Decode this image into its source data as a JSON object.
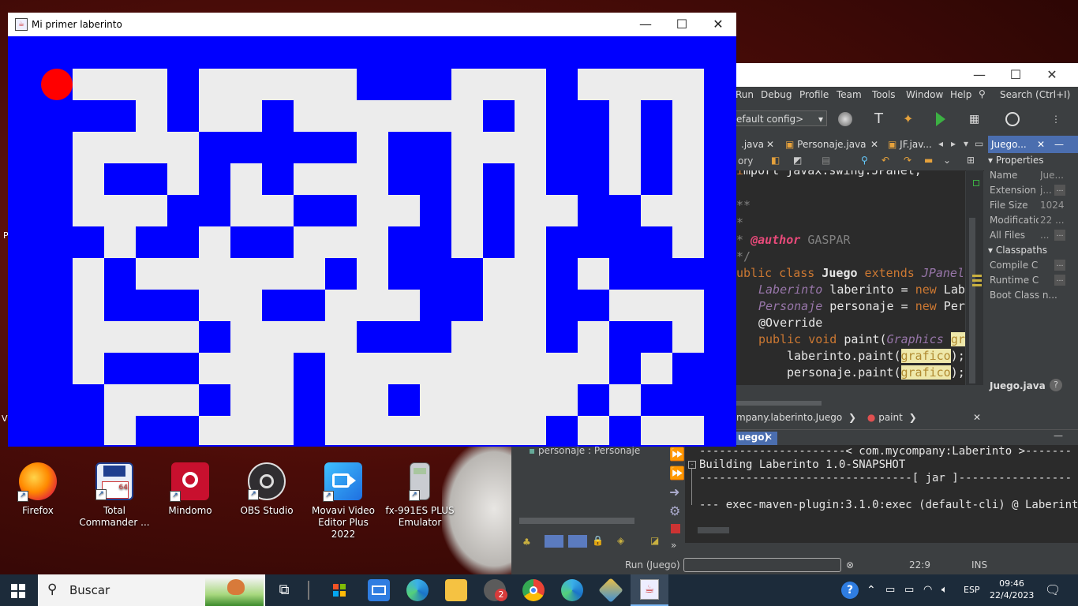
{
  "maze_window": {
    "title": "Mi primer laberinto",
    "colors": {
      "wall": "#0000ff",
      "path": "#ececec",
      "player": "#ff0000"
    }
  },
  "desktop": {
    "icons": [
      {
        "label": "Firefox"
      },
      {
        "label": "Total Commander ..."
      },
      {
        "label": "Mindomo"
      },
      {
        "label": "OBS Studio"
      },
      {
        "label": "Movavi Video Editor Plus 2022"
      },
      {
        "label": "fx-991ES PLUS Emulator"
      }
    ]
  },
  "ide": {
    "menu": [
      "Run",
      "Debug",
      "Profile",
      "Team",
      "Tools",
      "Window",
      "Help"
    ],
    "search_placeholder": "Search (Ctrl+I)",
    "config": "efault config>",
    "tabs": [
      ".java",
      "Personaje.java",
      "JF.jav..."
    ],
    "history_label": "ory",
    "properties_tab": "Juego...",
    "properties": {
      "header": "Properties",
      "rows": [
        {
          "key": "Name",
          "value": "Jue..."
        },
        {
          "key": "Extension",
          "value": "j..."
        },
        {
          "key": "File Size",
          "value": "1024"
        },
        {
          "key": "Modificatio",
          "value": "22 ..."
        },
        {
          "key": "All Files",
          "value": "..."
        }
      ],
      "classpaths_header": "Classpaths",
      "classpath_rows": [
        "Compile C",
        "Runtime C",
        "Boot Class n..."
      ],
      "footer_file": "Juego.java"
    },
    "code": {
      "l1": "mport javax.swing.JPanel;",
      "l2": "**",
      "l3": "*",
      "l4_tag": "@author",
      "l4_name": "GASPAR",
      "l5": "*/",
      "l6_a": "ublic class ",
      "l6_b": "Juego",
      "l6_c": " extends ",
      "l6_d": "JPanel",
      "l7_a": "Laberinto",
      "l7_b": " laberinto = ",
      "l7_c": "new",
      "l7_d": " Lab",
      "l8_a": "Personaje",
      "l8_b": " personaje = ",
      "l8_c": "new",
      "l8_d": " Per",
      "l9": "@Override",
      "l10_a": "public void ",
      "l10_b": "paint(",
      "l10_c": "Graphics",
      "l10_d": "gr",
      "l11_a": "laberinto.paint(",
      "l11_b": "grafico",
      "l11_c": ");",
      "l12_a": "personaje.paint(",
      "l12_b": "grafico",
      "l12_c": ");"
    },
    "breadcrumb": {
      "path": "mpany.laberinto.Juego",
      "method": "paint"
    },
    "output_tab": "uego)",
    "navigator_item": "personaje : Personaje",
    "output_lines": [
      "----------------------< com.mycompany:Laberinto >-------",
      "Building Laberinto 1.0-SNAPSHOT",
      "--------------------------------[ jar ]-----------------",
      "",
      "--- exec-maven-plugin:3.1.0:exec (default-cli) @ Laberint"
    ],
    "status": {
      "run": "Run (Juego)",
      "position": "22:9",
      "mode": "INS"
    }
  },
  "taskbar": {
    "search": "Buscar",
    "chat_badge": "2",
    "lang": "ESP",
    "time": "09:46",
    "date": "22/4/2023"
  }
}
